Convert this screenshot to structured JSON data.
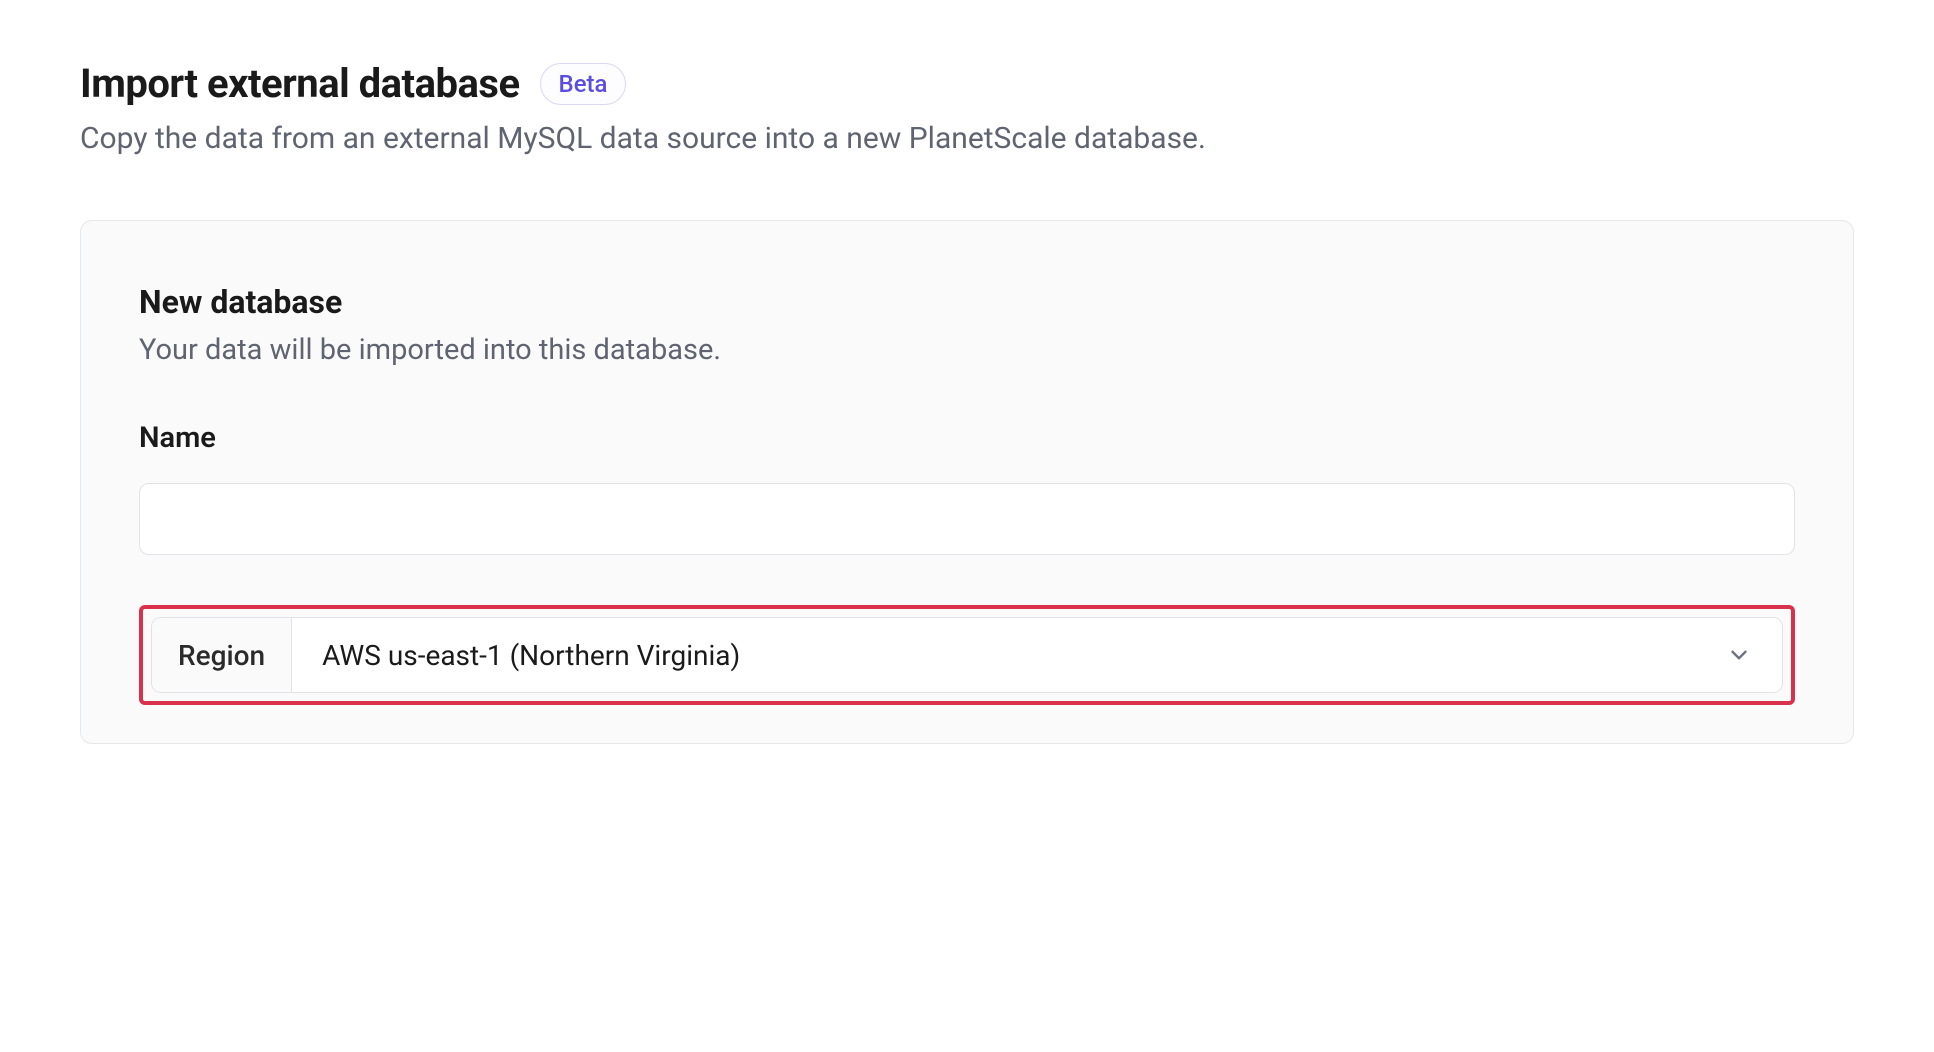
{
  "header": {
    "title": "Import external database",
    "badge": "Beta",
    "subtitle": "Copy the data from an external MySQL data source into a new PlanetScale database."
  },
  "card": {
    "section_title": "New database",
    "section_subtitle": "Your data will be imported into this database.",
    "name_label": "Name",
    "name_value": "",
    "region_label": "Region",
    "region_value": "AWS us-east-1 (Northern Virginia)"
  }
}
